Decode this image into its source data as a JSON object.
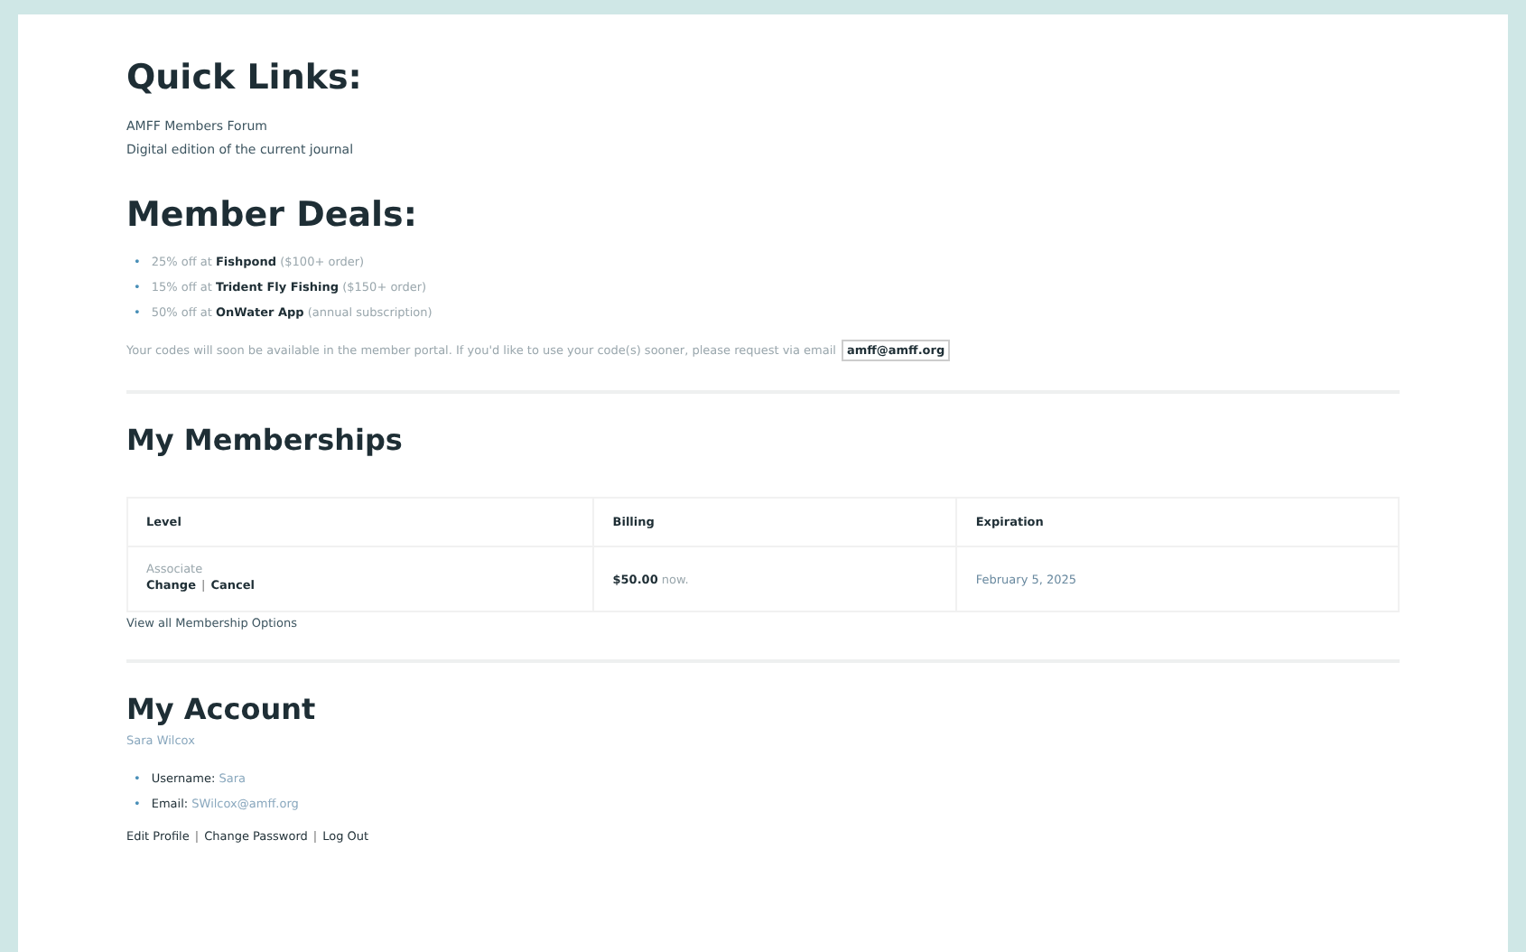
{
  "quick_links": {
    "title": "Quick Links:",
    "links": [
      "AMFF Members Forum",
      "Digital edition of the current journal"
    ]
  },
  "bullet": "•",
  "member_deals": {
    "title": "Member Deals:",
    "deals": [
      "25% off at **Fishpond** ($100+ order)",
      "15% off at **Trident Fly Fishing** ($150+ order)",
      "50% off at **OnWater App** (annual subscription)"
    ],
    "note": "Your codes will soon be available in the member portal. If you'd like to use your code(s) sooner, please request via email",
    "email": "amff@amff.org"
  },
  "memberships": {
    "title": "My Memberships",
    "columns": [
      "Level",
      "Billing",
      "Expiration"
    ],
    "rows": [
      {
        "level": "Associate",
        "actions": [
          "Change",
          "Cancel"
        ],
        "billing": "**$50.00** now.",
        "expiration": "February 5, 2025"
      }
    ],
    "separator": "|",
    "view_all": "View all Membership Options"
  },
  "account": {
    "title": "My Account",
    "name": "Sara Wilcox",
    "fields": [
      {
        "label": "Username:",
        "value": "Sara"
      },
      {
        "label": "Email:",
        "value": "SWilcox@amff.org"
      }
    ],
    "links": [
      "Edit Profile",
      "Change Password",
      "Log Out"
    ],
    "separator": "|"
  }
}
